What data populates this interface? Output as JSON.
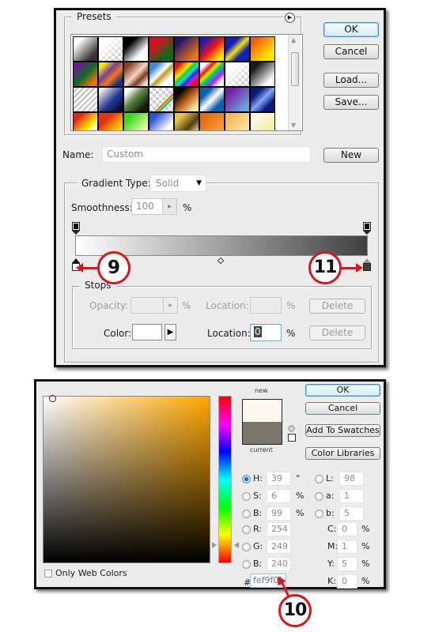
{
  "gradient_editor": {
    "buttons": {
      "ok": "OK",
      "cancel": "Cancel",
      "load": "Load...",
      "save": "Save...",
      "new": "New"
    },
    "presets": {
      "title": "Presets",
      "menu_icon": "circle-arrow-right-icon",
      "swatches": [
        [
          "linear-gradient(135deg,#fff 20%,#333 80%)",
          "checker-white",
          "linear-gradient(135deg,#000 25%,#fff 70%)",
          "linear-gradient(135deg,#d0141e 30%,#0b6b1d 75%)",
          "linear-gradient(135deg,#2a1267 20%,#f07a12 85%)",
          "linear-gradient(135deg,#1a1ab0 15%,#e81416 50%,#ffe600 85%)",
          "linear-gradient(135deg,#1520b2 30%,#f1e50f 50%,#1520b2 70%)",
          "linear-gradient(135deg,#f05b10 15%,#ffe200 75%)"
        ],
        [
          "linear-gradient(135deg,#6b1b8e 15%,#0f6a26 50%,#f07010 85%)",
          "linear-gradient(135deg,#f5e50e 15%,#7c3ea3 40%,#f07a12 60%,#1b2e8c 85%)",
          "linear-gradient(135deg,#8a4020 15%,#f2d6c2 50%,#7c3d21 70%,#efe0d8 90%)",
          "linear-gradient(135deg,#3a8ad8 20%,#ffffff 45%,#c69a20 55%,#fff 75%)",
          "linear-gradient(135deg,#e0161b 15%,#ff8a00 25%,#ffe800 35%,#17d62a 45%,#18d9e4 55%,#1e2de6 65%,#cf18d7 75%,#e0161b 85%)",
          "linear-gradient(135deg,#fff 15%,#e0161b 30%,#ffe800 40%,#17d62a 50%,#1e8ce6 60%,#cf18d7 70%,#fff 85%)",
          "checker-white",
          "linear-gradient(135deg,#1a1a1a 20%,#fff 80%)"
        ],
        [
          "checker-stripe",
          "linear-gradient(135deg,#f4ede6 10%,#243b9a 55%,#0b0b30 90%)",
          "linear-gradient(135deg,#fff 15%,#5f8440 45%,#0c1a06 85%)",
          "checker-rainbow",
          "linear-gradient(135deg,#000 20%,#b85d1a 50%,#f7e5a2 85%)",
          "linear-gradient(135deg,#0d61b0 25%,#ffffff 50%,#0d61b0 75%)",
          "linear-gradient(135deg,#7a1ea8 20%,#6aa7de 85%)",
          "linear-gradient(135deg,#0c1a7a 25%,#7ea7ff 50%,#0c1a7a 75%)"
        ],
        [
          "linear-gradient(135deg,#e6241a 20%,#ffe600 60%,#fff 80%)",
          "linear-gradient(135deg,#e23410 30%,#ffe000 80%)",
          "linear-gradient(135deg,#38d815 20%,#f4fbb0 80%)",
          "linear-gradient(135deg,#2a52d6 20%,#ffffff 70%)",
          "linear-gradient(135deg,#e4c84a 20%,#533e10 60%,#f1e7b0 90%)",
          "linear-gradient(135deg,#e56c12 20%,#f5a23a 80%)",
          "linear-gradient(135deg,#f7b85a 20%,#fbe6a8 80%)",
          "linear-gradient(135deg,#fbf9e6 20%,#f6f19a 80%)"
        ]
      ]
    },
    "name": {
      "label": "Name:",
      "value": "Custom"
    },
    "gradient_type": {
      "label": "Gradient Type:",
      "value": "Solid"
    },
    "smoothness": {
      "label": "Smoothness:",
      "value": "100",
      "unit": "%"
    },
    "gradient_bar": {
      "start_color": "#ffffff",
      "end_color": "#404040",
      "midpoint_percent": 50
    },
    "stops": {
      "title": "Stops",
      "opacity_label": "Opacity:",
      "opacity_value": "",
      "opacity_unit": "%",
      "opacity_location_label": "Location:",
      "opacity_location_value": "",
      "opacity_location_unit": "%",
      "delete_label": "Delete",
      "color_label": "Color:",
      "color_value": "#ffffff",
      "color_location_label": "Location:",
      "color_location_value": "0",
      "color_location_unit": "%"
    }
  },
  "color_picker": {
    "buttons": {
      "ok": "OK",
      "cancel": "Cancel",
      "add_to_swatches": "Add To Swatches",
      "color_libraries": "Color Libraries"
    },
    "new_label": "new",
    "current_label": "current",
    "new_color": "#fef9f0",
    "current_color": "#7b776d",
    "hue_base_color": "#ffa500",
    "only_web_colors_label": "Only Web Colors",
    "only_web_colors_checked": false,
    "hsb": [
      {
        "label": "H:",
        "value": "39",
        "unit": "°",
        "selected": true
      },
      {
        "label": "S:",
        "value": "6",
        "unit": "%",
        "selected": false
      },
      {
        "label": "B:",
        "value": "99",
        "unit": "%",
        "selected": false
      }
    ],
    "rgb": [
      {
        "label": "R:",
        "value": "254"
      },
      {
        "label": "G:",
        "value": "249"
      },
      {
        "label": "B:",
        "value": "240"
      }
    ],
    "lab": [
      {
        "label": "L:",
        "value": "98"
      },
      {
        "label": "a:",
        "value": "1"
      },
      {
        "label": "b:",
        "value": "5"
      }
    ],
    "cmyk": [
      {
        "label": "C:",
        "value": "0",
        "unit": "%"
      },
      {
        "label": "M:",
        "value": "1",
        "unit": "%"
      },
      {
        "label": "Y:",
        "value": "5",
        "unit": "%"
      },
      {
        "label": "K:",
        "value": "0",
        "unit": "%"
      }
    ],
    "hex_label": "#",
    "hex_value": "fef9f0"
  },
  "callouts": {
    "stop_left": "9",
    "hex_field": "10",
    "stop_right": "11"
  },
  "colors": {
    "callout_red": "#d8161b",
    "default_button_blue": "#3b8fc7"
  }
}
